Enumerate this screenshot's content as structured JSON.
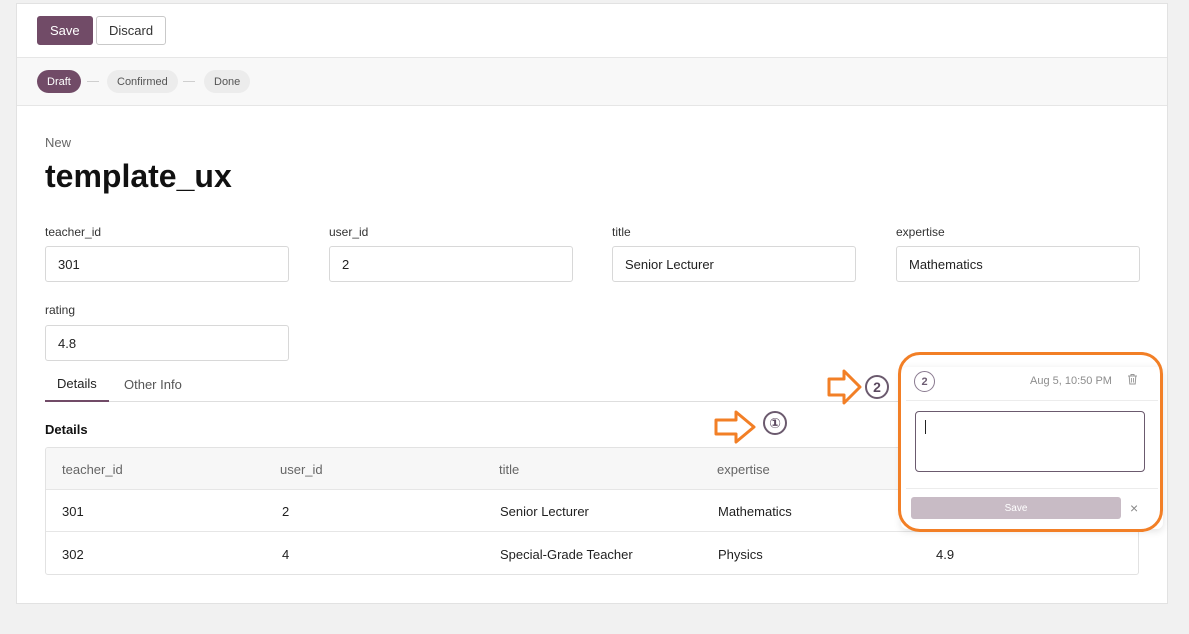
{
  "toolbar": {
    "save_label": "Save",
    "discard_label": "Discard"
  },
  "statusbar": {
    "stages": [
      "Draft",
      "Confirmed",
      "Done"
    ],
    "active": "Draft"
  },
  "record": {
    "breadcrumb": "New",
    "title": "template_ux"
  },
  "fields": {
    "teacher_id": {
      "label": "teacher_id",
      "value": "301"
    },
    "user_id": {
      "label": "user_id",
      "value": "2"
    },
    "title": {
      "label": "title",
      "value": "Senior Lecturer"
    },
    "expertise": {
      "label": "expertise",
      "value": "Mathematics"
    },
    "rating": {
      "label": "rating",
      "value": "4.8"
    }
  },
  "tabs": [
    "Details",
    "Other Info"
  ],
  "details": {
    "section_title": "Details",
    "columns": [
      "teacher_id",
      "user_id",
      "title",
      "expertise"
    ],
    "rows": [
      [
        "301",
        "2",
        "Senior Lecturer",
        "Mathematics",
        ""
      ],
      [
        "302",
        "4",
        "Special-Grade Teacher",
        "Physics",
        "4.9"
      ]
    ]
  },
  "annotations": {
    "marker_1": "①",
    "marker_2": "2"
  },
  "comment_popup": {
    "avatar": "2",
    "timestamp": "Aug 5, 10:50 PM",
    "save_label": "Save",
    "close_glyph": "×"
  },
  "colors": {
    "brand": "#714b67",
    "annotation": "#f27f26"
  }
}
